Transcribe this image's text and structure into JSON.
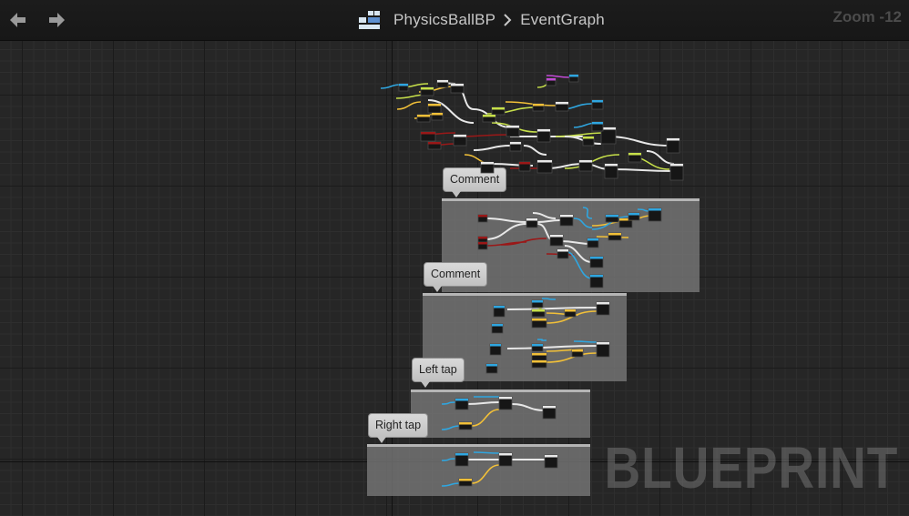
{
  "header": {
    "back_label": "back",
    "forward_label": "forward",
    "blueprint_name": "PhysicsBallBP",
    "graph_name": "EventGraph",
    "zoom_text": "Zoom -12"
  },
  "comments": [
    {
      "title": "Comment"
    },
    {
      "title": "Comment"
    },
    {
      "title": "Left tap"
    },
    {
      "title": "Right tap"
    }
  ],
  "watermark": "BLUEPRINT",
  "colors": {
    "exec": "#e8e8e8",
    "float": "#f2c038",
    "bool": "#9a1818",
    "object": "#2fa6e0",
    "vector": "#c7e04a",
    "struct": "#c24bd6",
    "node_body": "#161616"
  }
}
